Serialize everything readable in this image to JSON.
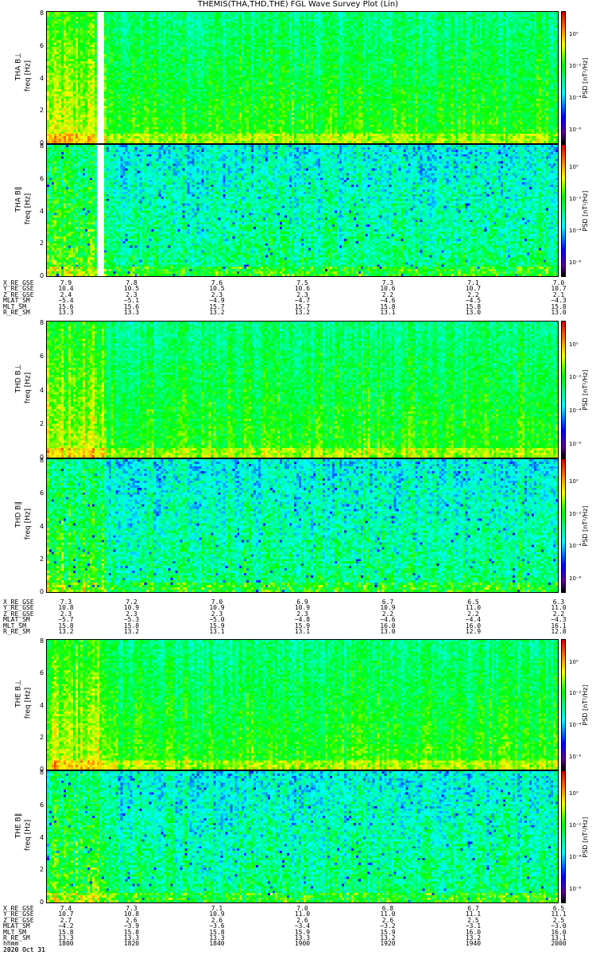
{
  "title": "THEMIS(THA,THD,THE) FGL Wave Survey Plot (Lin)",
  "chart_data": {
    "type": "heatmap",
    "title": "THEMIS(THA,THD,THE) FGL Wave Survey Plot (Lin)",
    "xlabel": "hhmm",
    "date": "2020 Oct 31",
    "x_ticks": [
      "1800",
      "1820",
      "1840",
      "1900",
      "1920",
      "1940",
      "2000"
    ],
    "ylabel": "freq [Hz]",
    "ylim": [
      0,
      8
    ],
    "y_ticks": [
      "0",
      "2",
      "4",
      "6",
      "8"
    ],
    "colorbar": {
      "label": "PSD [nT²/Hz]",
      "scale": "log",
      "range_log10": [
        -7,
        1
      ],
      "ticks": [
        "10⁰",
        "10⁻²",
        "10⁻⁴",
        "10⁻⁶"
      ]
    },
    "probes": [
      {
        "name": "THA",
        "panels": [
          {
            "label": "THA B⊥",
            "component": "perp"
          },
          {
            "label": "THA B∥",
            "component": "par"
          }
        ],
        "data_gap": [
          "1806",
          "1808"
        ],
        "ephemeris": {
          "labels": [
            "X_RE_GSE",
            "Y_RE_GSE",
            "Z_RE_GSE",
            "MLAT_SM",
            "MLT_SM",
            "R_RE_SM"
          ],
          "rows": [
            [
              "7.9",
              "7.8",
              "7.6",
              "7.5",
              "7.3",
              "7.1",
              "7.0"
            ],
            [
              "10.4",
              "10.5",
              "10.5",
              "10.6",
              "10.6",
              "10.7",
              "10.7"
            ],
            [
              "2.4",
              "2.3",
              "2.3",
              "2.3",
              "2.2",
              "2.2",
              "2.1"
            ],
            [
              "−5.4",
              "−5.1",
              "−4.9",
              "−4.7",
              "−4.6",
              "−4.5",
              "−4.3"
            ],
            [
              "15.6",
              "15.6",
              "15.7",
              "15.7",
              "15.8",
              "15.8",
              "15.8"
            ],
            [
              "13.3",
              "13.3",
              "13.2",
              "13.2",
              "13.1",
              "13.0",
              "13.0"
            ]
          ]
        }
      },
      {
        "name": "THD",
        "panels": [
          {
            "label": "THD B⊥",
            "component": "perp"
          },
          {
            "label": "THD B∥",
            "component": "par"
          }
        ],
        "ephemeris": {
          "labels": [
            "X_RE_GSE",
            "Y_RE_GSE",
            "Z_RE_GSE",
            "MLAT_SM",
            "MLT_SM",
            "R_RE_SM"
          ],
          "rows": [
            [
              "7.3",
              "7.2",
              "7.0",
              "6.9",
              "6.7",
              "6.5",
              "6.3"
            ],
            [
              "10.8",
              "10.9",
              "10.9",
              "10.9",
              "10.9",
              "11.0",
              "11.0"
            ],
            [
              "2.3",
              "2.3",
              "2.3",
              "2.3",
              "2.2",
              "2.2",
              "2.2"
            ],
            [
              "−5.7",
              "−5.3",
              "−5.0",
              "−4.8",
              "−4.6",
              "−4.4",
              "−4.3"
            ],
            [
              "15.8",
              "15.8",
              "15.9",
              "15.9",
              "16.0",
              "16.0",
              "16.1"
            ],
            [
              "13.2",
              "13.2",
              "13.1",
              "13.1",
              "13.0",
              "12.9",
              "12.8"
            ]
          ]
        }
      },
      {
        "name": "THE",
        "panels": [
          {
            "label": "THE B⊥",
            "component": "perp"
          },
          {
            "label": "THE B∥",
            "component": "par"
          }
        ],
        "ephemeris": {
          "labels": [
            "X_RE_GSE",
            "Y_RE_GSE",
            "Z_RE_GSE",
            "MLAT_SM",
            "MLT_SM",
            "R_RE_SM",
            "hhmm"
          ],
          "rows": [
            [
              "7.4",
              "7.3",
              "7.1",
              "7.0",
              "6.8",
              "6.7",
              "6.5"
            ],
            [
              "10.7",
              "10.8",
              "10.9",
              "11.0",
              "11.0",
              "11.1",
              "11.1"
            ],
            [
              "2.7",
              "2.6",
              "2.6",
              "2.6",
              "2.6",
              "2.5",
              "2.5"
            ],
            [
              "−4.2",
              "−3.9",
              "−3.6",
              "−3.4",
              "−3.2",
              "−3.1",
              "−3.0"
            ],
            [
              "15.8",
              "15.8",
              "15.8",
              "15.9",
              "15.9",
              "16.0",
              "16.0"
            ],
            [
              "13.3",
              "13.3",
              "13.3",
              "13.3",
              "13.2",
              "13.2",
              "13.1"
            ],
            [
              "1800",
              "1820",
              "1840",
              "1900",
              "1920",
              "1940",
              "2000"
            ]
          ],
          "date_label": "2020 Oct 31"
        }
      }
    ]
  }
}
